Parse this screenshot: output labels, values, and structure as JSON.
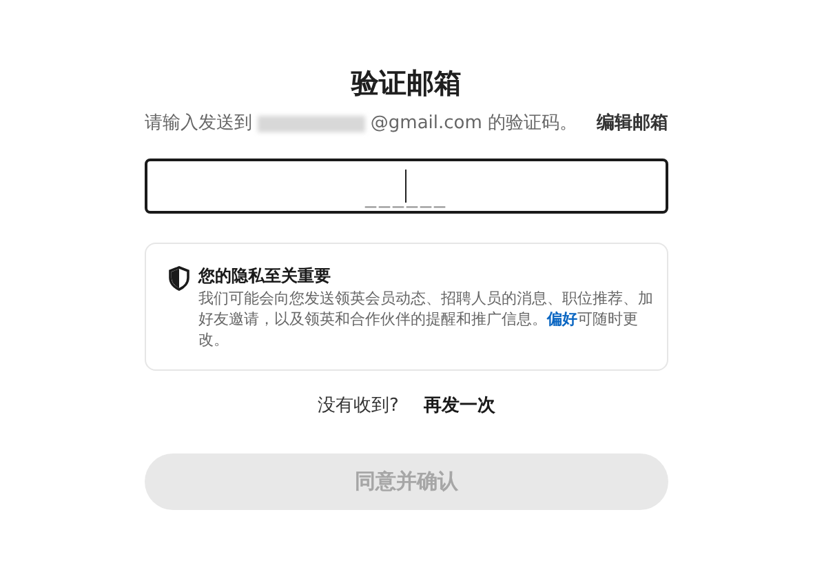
{
  "title": "验证邮箱",
  "instruction": {
    "prefix": "请输入发送到",
    "email_suffix": "@gmail.com 的验证码。",
    "edit_link": "编辑邮箱"
  },
  "code_field": {
    "placeholder": "______"
  },
  "privacy_notice": {
    "heading": "您的隐私至关重要",
    "body": "我们可能会向您发送领英会员动态、招聘人员的消息、职位推荐、加好友邀请，以及领英和合作伙伴的提醒和推广信息。",
    "link": "偏好",
    "body_end": "可随时更改。"
  },
  "resend": {
    "prompt": "没有收到?",
    "link": "再发一次"
  },
  "submit_button": {
    "label": "同意并确认",
    "disabled": true
  }
}
